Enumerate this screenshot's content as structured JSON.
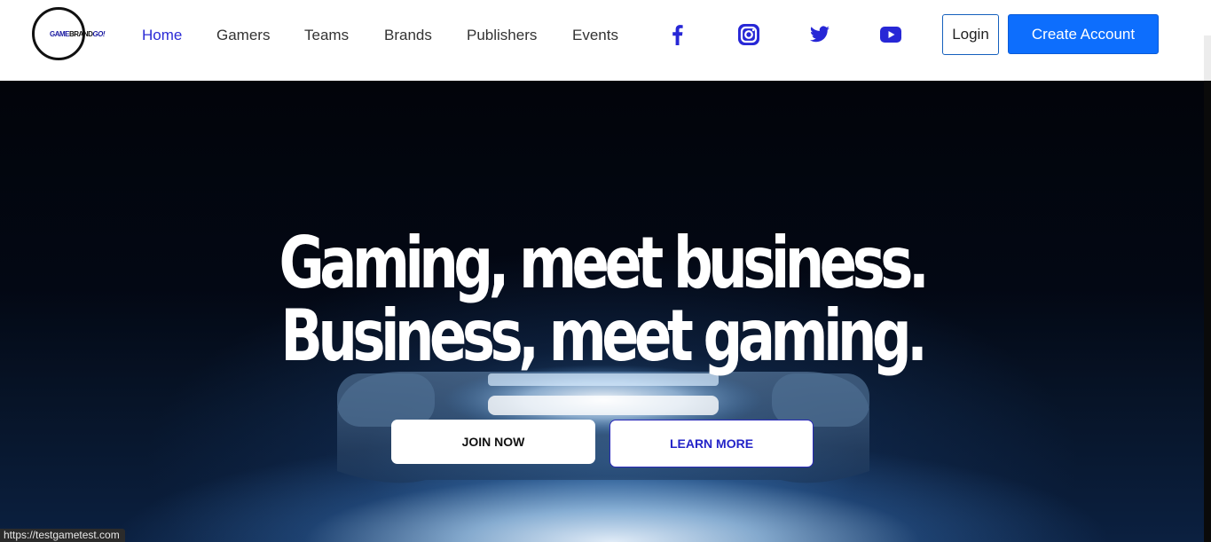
{
  "logo": {
    "part1": "GAME",
    "part2": "BRAND",
    "part3": "GO!"
  },
  "nav": {
    "items": [
      {
        "label": "Home",
        "active": true
      },
      {
        "label": "Gamers"
      },
      {
        "label": "Teams"
      },
      {
        "label": "Brands"
      },
      {
        "label": "Publishers"
      },
      {
        "label": "Events"
      }
    ]
  },
  "social": [
    "facebook-icon",
    "instagram-icon",
    "twitter-icon",
    "youtube-icon"
  ],
  "auth": {
    "login_label": "Login",
    "create_label": "Create Account"
  },
  "hero": {
    "line1": "Gaming, meet business.",
    "line2": "Business, meet gaming.",
    "join_label": "JOIN NOW",
    "learn_label": "LEARN MORE"
  },
  "status_bar": {
    "url": "https://testgametest.com"
  },
  "colors": {
    "accent": "#0d6efd",
    "nav_active": "#2b2bd6",
    "social": "#2727d6"
  }
}
